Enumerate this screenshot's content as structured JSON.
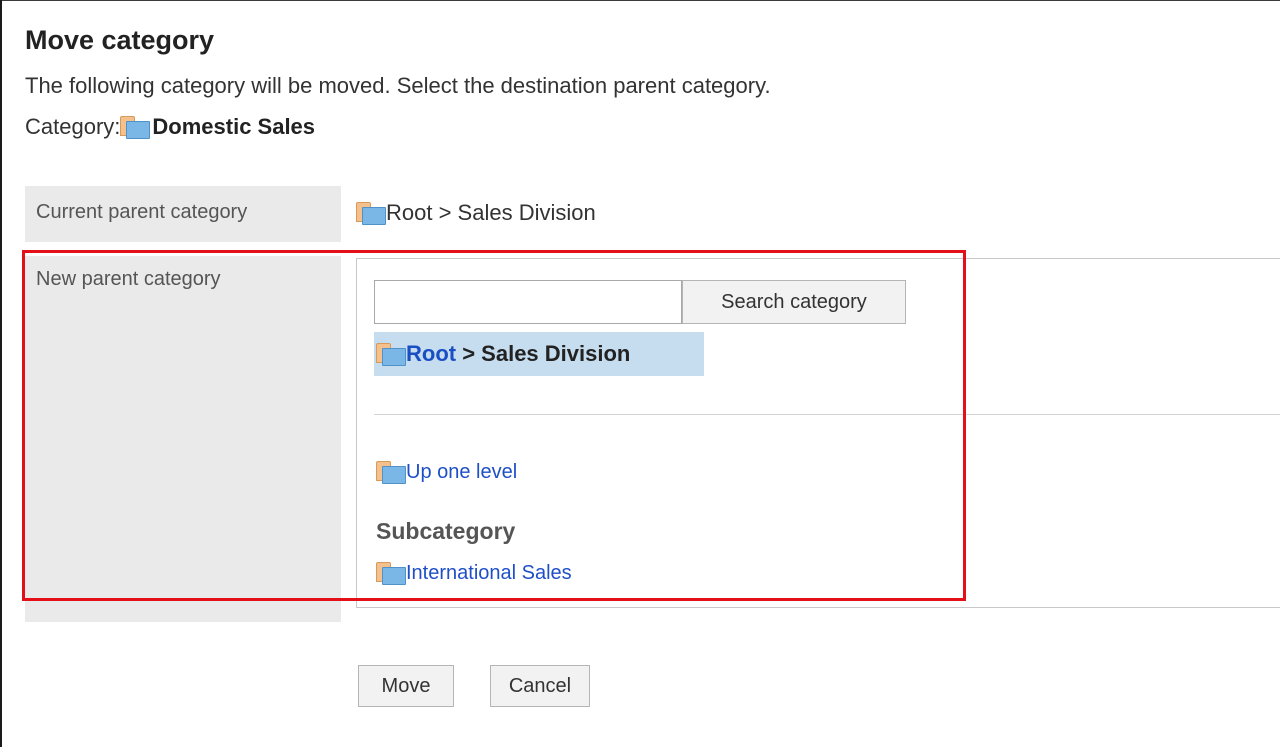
{
  "page": {
    "title": "Move category",
    "description": "The following category will be moved. Select the destination parent category.",
    "category_label": "Category:",
    "category_name": "Domestic Sales"
  },
  "form": {
    "current_parent_label": "Current parent category",
    "current_parent_value": "Root > Sales Division",
    "new_parent_label": "New parent category",
    "search_input_value": "",
    "search_button_label": "Search category",
    "selected_root": "Root",
    "selected_rest": " > Sales Division",
    "up_one_level": "Up one level",
    "subcategory_heading": "Subcategory",
    "subcategories": [
      "International Sales"
    ]
  },
  "actions": {
    "move_label": "Move",
    "cancel_label": "Cancel"
  },
  "colors": {
    "link": "#1f4fc8",
    "selected_bg": "#c6dcef",
    "highlight_border": "#e3101a",
    "label_bg": "#eaeaea"
  },
  "icons": {
    "folder": "folder-icon"
  }
}
